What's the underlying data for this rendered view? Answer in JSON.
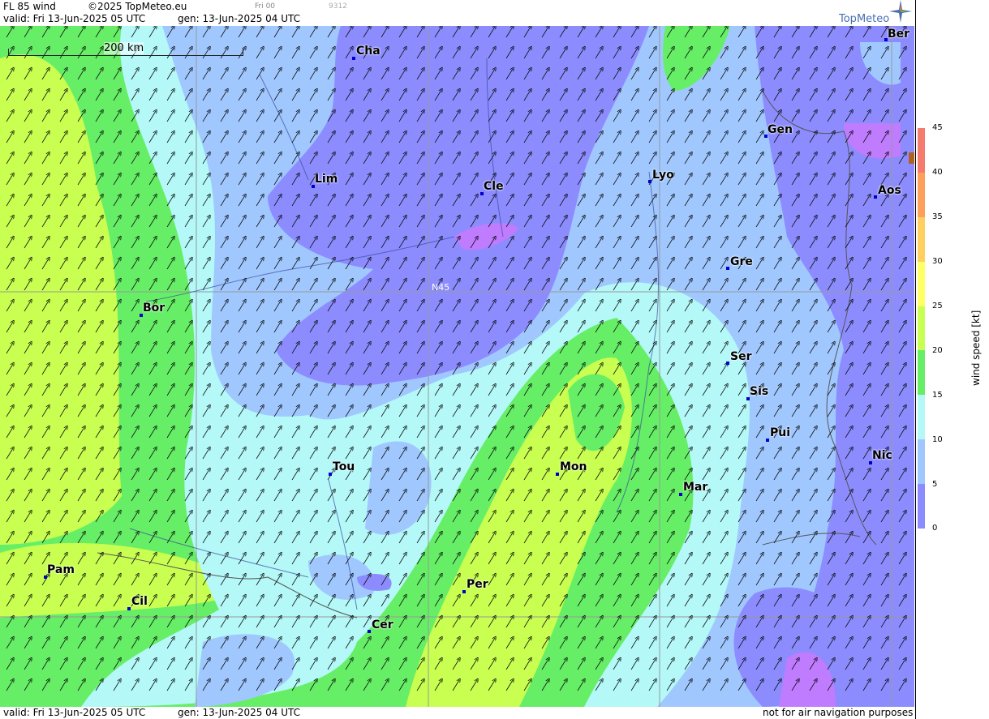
{
  "header": {
    "title": "FL 85 wind",
    "copyright": "©2025 TopMeteo.eu",
    "run": "Fri 00",
    "code": "9312",
    "valid": "valid:  Fri  13-Jun-2025  05 UTC",
    "gen": "gen: 13-Jun-2025 04 UTC"
  },
  "footer": {
    "valid": "valid:  Fri  13-Jun-2025  05 UTC",
    "gen": "gen: 13-Jun-2025 04 UTC",
    "disclaimer": "not for air navigation purposes"
  },
  "brand": {
    "name": "TopMeteo",
    "color": "#4a6fb0"
  },
  "scale_bar": {
    "label": "200 km"
  },
  "grid_label": "N45",
  "legend": {
    "title": "wind speed [kt]",
    "ticks": [
      "45",
      "40",
      "35",
      "30",
      "25",
      "20",
      "15",
      "10",
      "5",
      "0"
    ],
    "colors": [
      "#f47c6e",
      "#ff9f5c",
      "#ffd060",
      "#ffff66",
      "#c8ff50",
      "#66ee66",
      "#b4f8f8",
      "#a0c8ff",
      "#8c8cff",
      "#c07cff"
    ]
  },
  "cities": [
    {
      "name": "Ber"
    },
    {
      "name": "Cha"
    },
    {
      "name": "Gen"
    },
    {
      "name": "Lim"
    },
    {
      "name": "Cle"
    },
    {
      "name": "Lyo"
    },
    {
      "name": "Aos"
    },
    {
      "name": "Gre"
    },
    {
      "name": "Bor"
    },
    {
      "name": "Ser"
    },
    {
      "name": "Sis"
    },
    {
      "name": "Pui"
    },
    {
      "name": "Tou"
    },
    {
      "name": "Mon"
    },
    {
      "name": "Nic"
    },
    {
      "name": "Mar"
    },
    {
      "name": "Pam"
    },
    {
      "name": "Per"
    },
    {
      "name": "Cil"
    },
    {
      "name": "Cer"
    }
  ]
}
